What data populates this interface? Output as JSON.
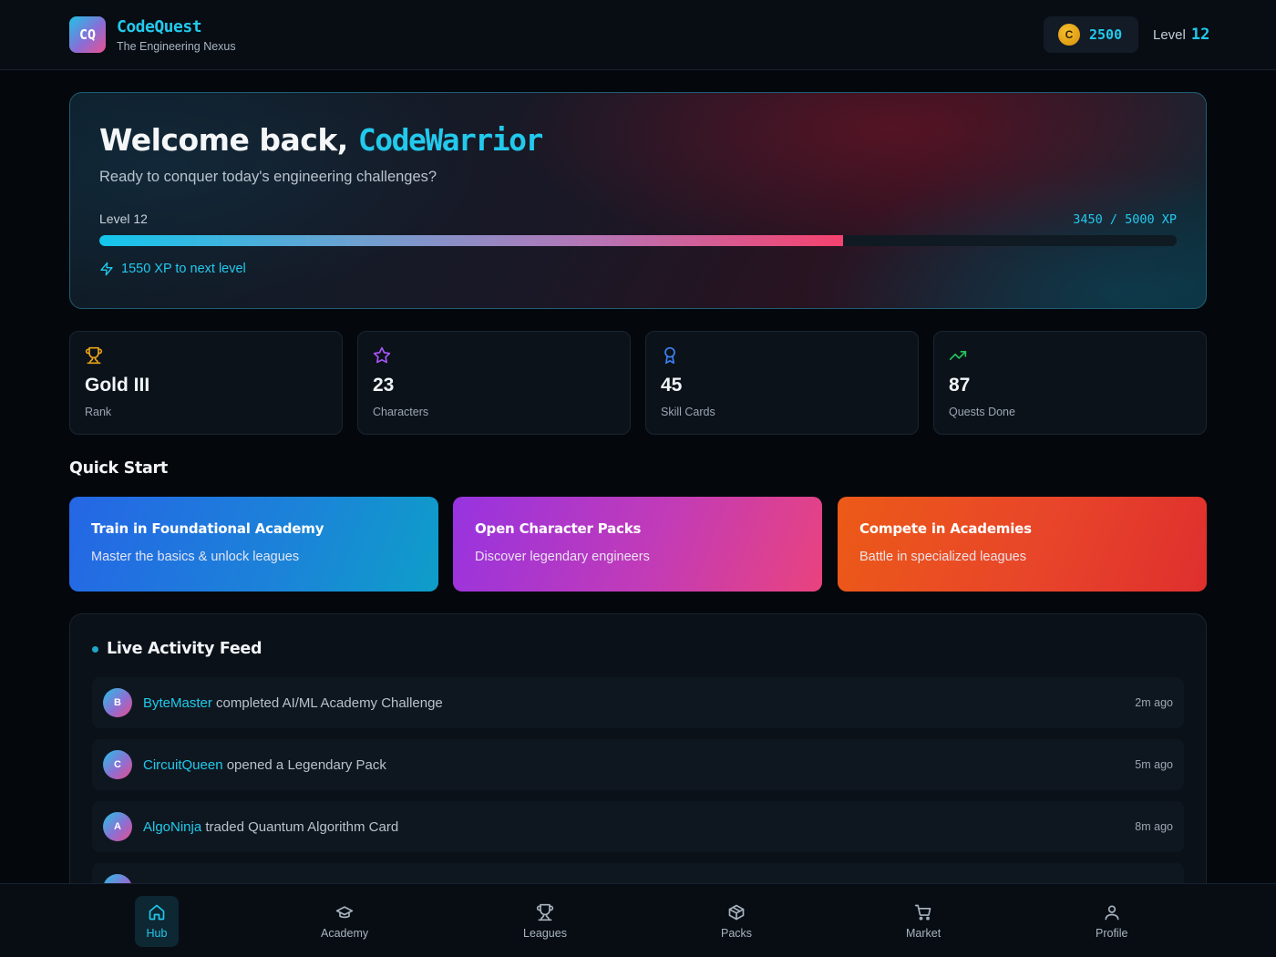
{
  "header": {
    "logo": "CQ",
    "app_name": "CodeQuest",
    "tagline": "The Engineering Nexus",
    "coin_letter": "C",
    "coins": "2500",
    "level_label": "Level",
    "level_value": "12"
  },
  "hero": {
    "welcome": "Welcome back,",
    "username": "CodeWarrior",
    "subtitle": "Ready to conquer today's engineering challenges?",
    "level": "Level 12",
    "xp_text": "3450 / 5000 XP",
    "xp_current": 3450,
    "xp_max": 5000,
    "xp_next": "1550 XP to next level"
  },
  "stats": [
    {
      "value": "Gold III",
      "label": "Rank",
      "icon": "trophy-icon"
    },
    {
      "value": "23",
      "label": "Characters",
      "icon": "star-icon"
    },
    {
      "value": "45",
      "label": "Skill Cards",
      "icon": "award-icon"
    },
    {
      "value": "87",
      "label": "Quests Done",
      "icon": "trending-up-icon"
    }
  ],
  "quick_start": {
    "title": "Quick Start",
    "cards": [
      {
        "title": "Train in Foundational Academy",
        "subtitle": "Master the basics & unlock leagues"
      },
      {
        "title": "Open Character Packs",
        "subtitle": "Discover legendary engineers"
      },
      {
        "title": "Compete in Academies",
        "subtitle": "Battle in specialized leagues"
      }
    ]
  },
  "feed": {
    "title": "Live Activity Feed",
    "items": [
      {
        "initial": "B",
        "user": "ByteMaster",
        "action": " completed AI/ML Academy Challenge",
        "time": "2m ago"
      },
      {
        "initial": "C",
        "user": "CircuitQueen",
        "action": " opened a Legendary Pack",
        "time": "5m ago"
      },
      {
        "initial": "A",
        "user": "AlgoNinja",
        "action": " traded Quantum Algorithm Card",
        "time": "8m ago"
      }
    ]
  },
  "nav": {
    "items": [
      {
        "label": "Hub",
        "icon": "home-icon",
        "active": true
      },
      {
        "label": "Academy",
        "icon": "graduation-cap-icon"
      },
      {
        "label": "Leagues",
        "icon": "trophy-icon"
      },
      {
        "label": "Packs",
        "icon": "package-icon"
      },
      {
        "label": "Market",
        "icon": "cart-icon"
      },
      {
        "label": "Profile",
        "icon": "user-icon"
      }
    ]
  },
  "colors": {
    "accent": "#22c9ec",
    "background": "#04080d",
    "gold": "#e8a317",
    "purple": "#a855f7",
    "blue": "#3b82f6",
    "green": "#22c55e"
  }
}
